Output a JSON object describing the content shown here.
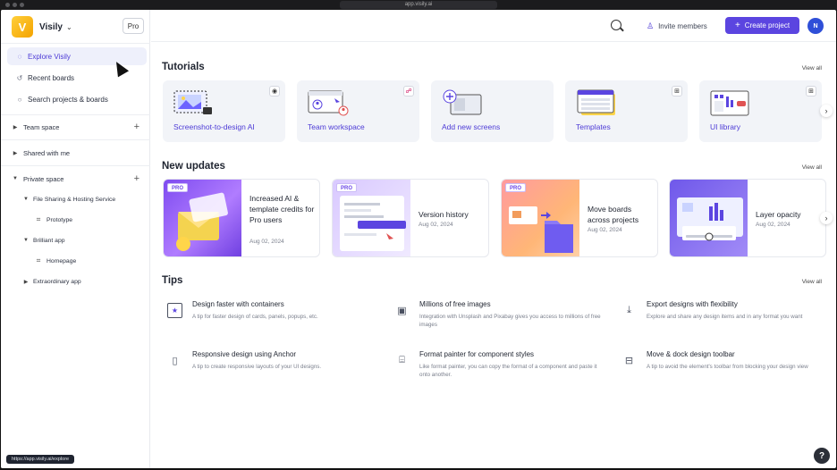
{
  "browser": {
    "url": "app.visily.ai"
  },
  "sidebar": {
    "workspace": {
      "logo_letter": "V",
      "name": "Visily",
      "chevron": "chevron-down-icon"
    },
    "pro_label": "Pro",
    "nav": [
      {
        "label": "Explore Visily",
        "icon": "bulb-icon"
      },
      {
        "label": "Recent boards",
        "icon": "history-icon"
      },
      {
        "label": "Search projects & boards",
        "icon": "search-icon"
      }
    ],
    "team_space": "Team space",
    "shared_with_me": "Shared with me",
    "private_space": "Private space",
    "projects": [
      {
        "label": "File Sharing & Hosting Service",
        "children": [
          "Prototype"
        ]
      },
      {
        "label": "Brilliant app",
        "children": [
          "Homepage"
        ]
      },
      {
        "label": "Extraordinary app",
        "children": []
      }
    ],
    "status_url": "https://app.visily.ai/explore"
  },
  "topbar": {
    "invite_label": "Invite members",
    "create_label": "Create project",
    "avatar_initial": "N"
  },
  "tutorials": {
    "title": "Tutorials",
    "view_all": "View all",
    "cards": [
      {
        "label": "Screenshot-to-design AI",
        "corner_icon": "ai-icon"
      },
      {
        "label": "Team workspace",
        "corner_icon": "team-icon"
      },
      {
        "label": "Add new screens",
        "corner_icon": ""
      },
      {
        "label": "Templates",
        "corner_icon": "add-screen-icon"
      },
      {
        "label": "UI library",
        "corner_icon": "add-screen-icon"
      }
    ]
  },
  "updates": {
    "title": "New updates",
    "view_all": "View all",
    "cards": [
      {
        "title": "Increased AI & template credits for Pro users",
        "date": "Aug 02, 2024",
        "pro": "PRO"
      },
      {
        "title": "Version history",
        "date": "Aug 02, 2024",
        "pro": "PRO"
      },
      {
        "title": "Move boards across projects",
        "date": "Aug 02, 2024",
        "pro": "PRO"
      },
      {
        "title": "Layer opacity",
        "date": "Aug 02, 2024",
        "pro": ""
      }
    ]
  },
  "tips": {
    "title": "Tips",
    "view_all": "View all",
    "items": [
      {
        "title": "Design faster with containers",
        "desc": "A tip for faster design of cards, panels, popups, etc.",
        "icon": "container-icon"
      },
      {
        "title": "Millions of free images",
        "desc": "Integration with Unsplash and Pixabay gives you access to millions of free images",
        "icon": "image-icon"
      },
      {
        "title": "Export designs with flexibility",
        "desc": "Explore and share any design items and in any format you want",
        "icon": "export-icon"
      },
      {
        "title": "Responsive design using Anchor",
        "desc": "A tip to create responsive layouts of your UI designs.",
        "icon": "responsive-icon"
      },
      {
        "title": "Format painter for component styles",
        "desc": "Like format painter, you can copy the format of a component and paste it onto another.",
        "icon": "format-painter-icon"
      },
      {
        "title": "Move & dock design toolbar",
        "desc": "A tip to avoid the element's toolbar from blocking your design view",
        "icon": "toolbar-icon"
      }
    ]
  },
  "help_label": "?",
  "colors": {
    "accent": "#5b45e0",
    "brand_yellow": "#f4b400",
    "avatar": "#2f4fd8"
  }
}
